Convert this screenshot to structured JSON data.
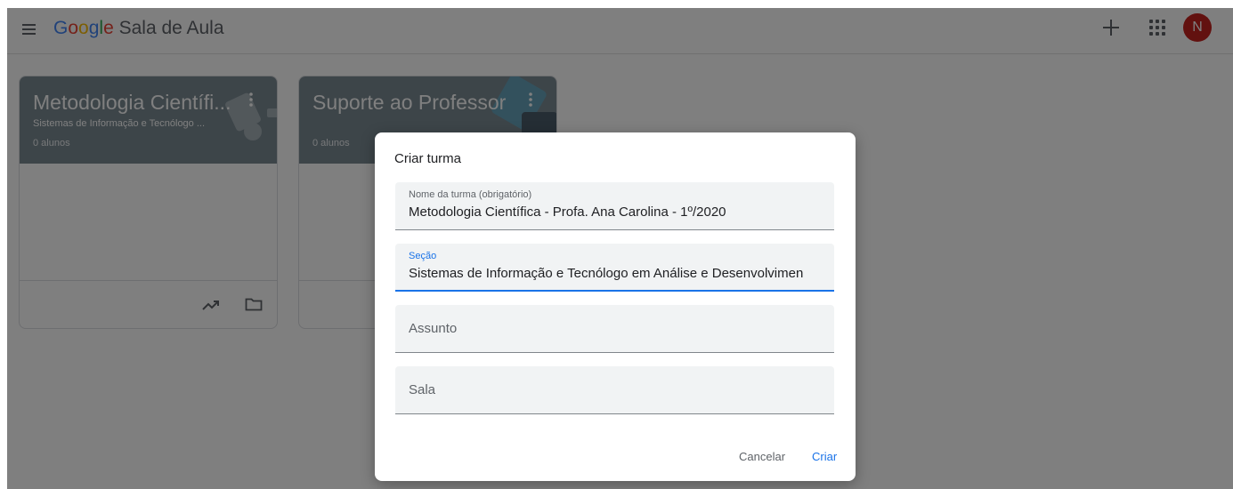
{
  "header": {
    "menu_icon": "hamburger-menu-icon",
    "brand_google": [
      "G",
      "o",
      "o",
      "g",
      "l",
      "e"
    ],
    "brand_app": " Sala de Aula",
    "add_icon": "plus-icon",
    "apps_icon": "apps-grid-icon",
    "avatar_initial": "N",
    "avatar_color": "#c5221f"
  },
  "cards": [
    {
      "title": "Metodologia Científi...",
      "subtitle": "Sistemas de Informação e Tecnólogo ...",
      "count": "0 alunos",
      "header_color": "#7b8a93",
      "footer_icons": [
        "trending-up-icon",
        "folder-icon"
      ]
    },
    {
      "title": "Suporte ao Professor",
      "count": "0 alunos",
      "header_color": "#7b8a93"
    }
  ],
  "dialog": {
    "title": "Criar turma",
    "fields": [
      {
        "label": "Nome da turma (obrigatório)",
        "value": "Metodologia Científica - Profa. Ana Carolina - 1º/2020"
      },
      {
        "label": "Seção",
        "value": "Sistemas de Informação e  Tecnólogo em Análise e Desenvolvimen"
      },
      {
        "placeholder": "Assunto"
      },
      {
        "placeholder": "Sala"
      }
    ],
    "cancel_label": "Cancelar",
    "create_label": "Criar",
    "accent_color": "#1a73e8"
  }
}
